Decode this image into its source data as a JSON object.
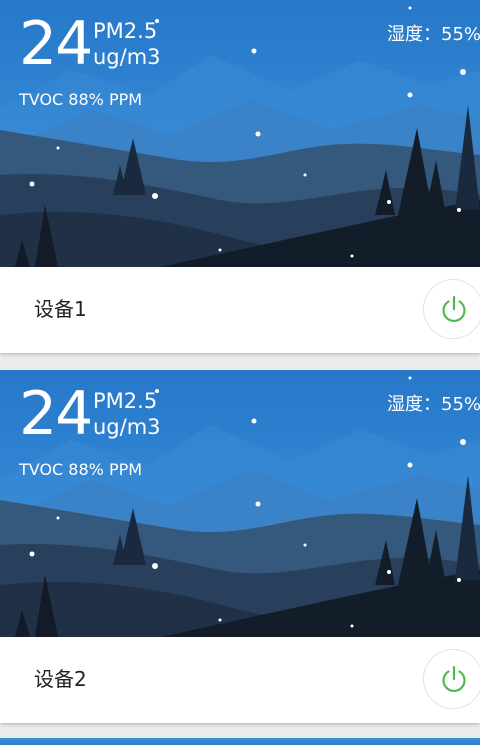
{
  "devices": [
    {
      "pm_value": "24",
      "pm_label": "PM2.5",
      "pm_unit": "ug/m3",
      "tvoc": "TVOC 88% PPM",
      "humidity": "湿度：55%",
      "name": "设备1",
      "power_icon": "power-icon",
      "power_color": "#4cbb4c"
    },
    {
      "pm_value": "24",
      "pm_label": "PM2.5",
      "pm_unit": "ug/m3",
      "tvoc": "TVOC 88% PPM",
      "humidity": "湿度：55%",
      "name": "设备2",
      "power_icon": "power-icon",
      "power_color": "#4cbb4c"
    }
  ],
  "colors": {
    "sky_top": "#2a7fd0",
    "sky_bottom": "#3a95e0",
    "mountain_far": "#4a7aa8",
    "mountain_mid": "#2e4a6a",
    "mountain_near": "#1e2d42",
    "foreground": "#121c29"
  }
}
